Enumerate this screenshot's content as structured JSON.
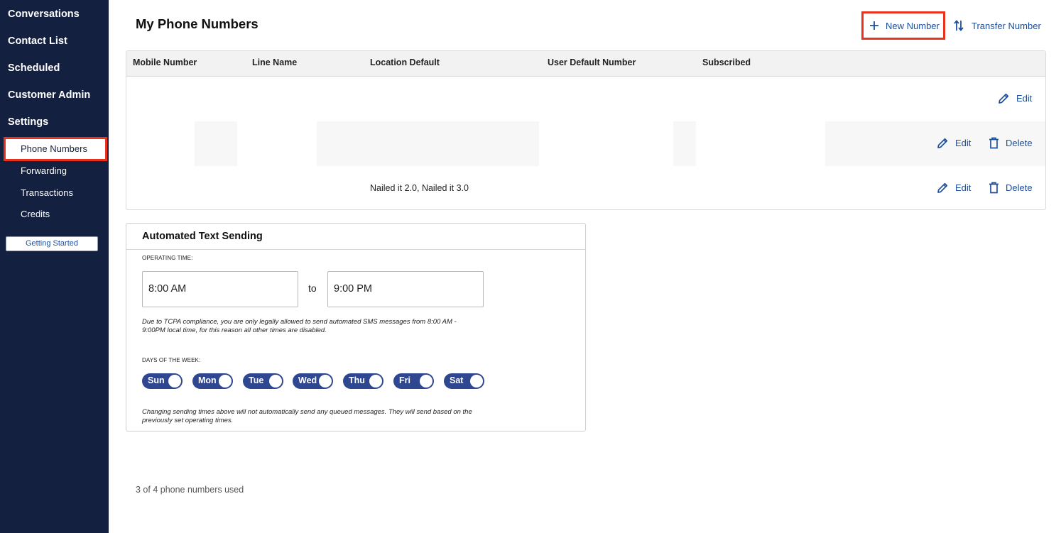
{
  "sidebar": {
    "main_items": [
      "Conversations",
      "Contact List",
      "Scheduled",
      "Customer Admin",
      "Settings"
    ],
    "sub_items": [
      "Phone Numbers",
      "Forwarding",
      "Transactions",
      "Credits"
    ],
    "active_sub_item": "Phone Numbers",
    "getting_started_label": "Getting Started"
  },
  "header": {
    "title": "My Phone Numbers",
    "new_number_label": "New Number",
    "transfer_number_label": "Transfer Number"
  },
  "table": {
    "columns": [
      "Mobile Number",
      "Line Name",
      "Location Default",
      "User Default Number",
      "Subscribed"
    ],
    "rows": [
      {
        "location_default": "",
        "actions": [
          "Edit"
        ]
      },
      {
        "location_default": "",
        "actions": [
          "Edit",
          "Delete"
        ]
      },
      {
        "location_default": "Nailed it 2.0, Nailed it 3.0",
        "actions": [
          "Edit",
          "Delete"
        ]
      }
    ],
    "edit_label": "Edit",
    "delete_label": "Delete"
  },
  "automated_text": {
    "title": "Automated Text Sending",
    "operating_time_label": "OPERATING TIME:",
    "start_time": "8:00 AM",
    "to_label": "to",
    "end_time": "9:00 PM",
    "compliance_note": "Due to TCPA compliance, you are only legally allowed to send automated SMS messages from 8:00 AM - 9:00PM local time, for this reason all other times are disabled.",
    "days_label": "DAYS OF THE WEEK:",
    "days": [
      {
        "label": "Sun",
        "enabled": true
      },
      {
        "label": "Mon",
        "enabled": true
      },
      {
        "label": "Tue",
        "enabled": true
      },
      {
        "label": "Wed",
        "enabled": true
      },
      {
        "label": "Thu",
        "enabled": true
      },
      {
        "label": "Fri",
        "enabled": true
      },
      {
        "label": "Sat",
        "enabled": true
      }
    ],
    "queue_note": "Changing sending times above will not automatically send any queued messages. They will send based on the previously set operating times."
  },
  "footer": {
    "usage_text": "3 of 4 phone numbers used"
  },
  "colors": {
    "sidebar_bg": "#13203f",
    "accent_blue": "#1d4f9c",
    "toggle_blue": "#2f4690",
    "highlight_red": "#e8321c"
  }
}
